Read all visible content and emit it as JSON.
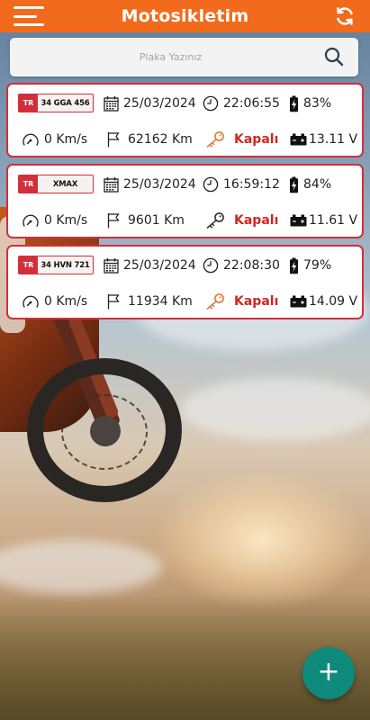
{
  "header": {
    "title": "Motosikletim",
    "menu_icon": "hamburger-menu-icon",
    "refresh_icon": "refresh-icon",
    "background_color": "#f26a1b"
  },
  "search": {
    "placeholder": "Plaka Yazınız",
    "value": "",
    "icon": "search-icon"
  },
  "colors": {
    "accent_red": "#d32f3a",
    "status_off": "#d3261f",
    "fab": "#0e8a7c"
  },
  "vehicles": [
    {
      "plate_country": "TR",
      "plate": "34 GGA 456",
      "date": "25/03/2024",
      "time": "22:06:55",
      "battery_percent": "83%",
      "speed": "0 Km/s",
      "distance": "62162 Km",
      "ignition": "Kapalı",
      "ignition_icon_color": "#e07a3a",
      "voltage": "13.11 V"
    },
    {
      "plate_country": "TR",
      "plate": "XMAX",
      "date": "25/03/2024",
      "time": "16:59:12",
      "battery_percent": "84%",
      "speed": "0 Km/s",
      "distance": "9601 Km",
      "ignition": "Kapalı",
      "ignition_icon_color": "#333333",
      "voltage": "11.61 V"
    },
    {
      "plate_country": "TR",
      "plate": "34 HVN 721",
      "date": "25/03/2024",
      "time": "22:08:30",
      "battery_percent": "79%",
      "speed": "0 Km/s",
      "distance": "11934 Km",
      "ignition": "Kapalı",
      "ignition_icon_color": "#e07a3a",
      "voltage": "14.09 V"
    }
  ],
  "fab": {
    "label": "+",
    "icon": "plus-icon"
  }
}
